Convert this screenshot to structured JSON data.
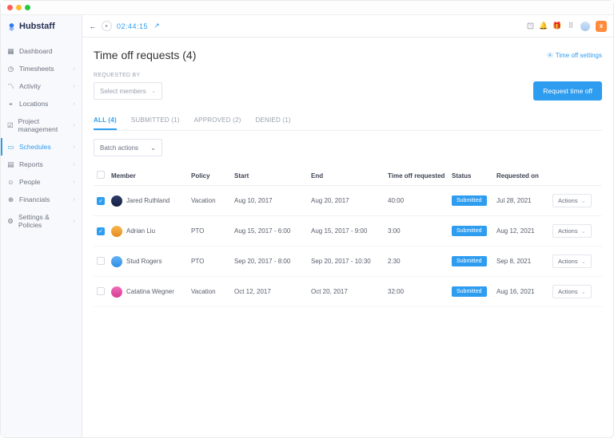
{
  "brand": "Hubstaff",
  "sidebar": {
    "items": [
      {
        "label": "Dashboard",
        "icon": "grid-icon",
        "chev": false
      },
      {
        "label": "Timesheets",
        "icon": "clock-icon",
        "chev": true
      },
      {
        "label": "Activity",
        "icon": "activity-icon",
        "chev": true
      },
      {
        "label": "Locations",
        "icon": "map-icon",
        "chev": true
      },
      {
        "label": "Project management",
        "icon": "clipboard-icon",
        "chev": true
      },
      {
        "label": "Schedules",
        "icon": "calendar-icon",
        "chev": true,
        "active": true
      },
      {
        "label": "Reports",
        "icon": "report-icon",
        "chev": true
      },
      {
        "label": "People",
        "icon": "people-icon",
        "chev": true
      },
      {
        "label": "Financials",
        "icon": "dollar-icon",
        "chev": true
      },
      {
        "label": "Settings & Policies",
        "icon": "sliders-icon",
        "chev": true
      }
    ]
  },
  "topbar": {
    "timer": "02:44:15",
    "org": "x"
  },
  "header": {
    "title": "Time off requests (4)",
    "settings_link": "Time off settings"
  },
  "filter": {
    "label": "REQUESTED BY",
    "select_placeholder": "Select members",
    "primary_button": "Request time off"
  },
  "tabs": [
    {
      "label": "ALL (4)",
      "active": true
    },
    {
      "label": "SUBMITTED (1)"
    },
    {
      "label": "APPROVED (2)"
    },
    {
      "label": "DENIED (1)"
    }
  ],
  "batch_actions": "Batch actions",
  "table": {
    "columns": [
      "",
      "Member",
      "Policy",
      "Start",
      "End",
      "Time off requested",
      "Status",
      "Requested on",
      ""
    ],
    "rows": [
      {
        "checked": true,
        "member": "Jared Ruthland",
        "policy": "Vacation",
        "start": "Aug 10, 2017",
        "end": "Aug 20, 2017",
        "requested": "40:00",
        "status": "Submitted",
        "on": "Jul 28, 2021",
        "actions": "Actions"
      },
      {
        "checked": true,
        "member": "Adrian Liu",
        "policy": "PTO",
        "start": "Aug 15, 2017 - 6:00",
        "end": "Aug 15, 2017 - 9:00",
        "requested": "3:00",
        "status": "Submitted",
        "on": "Aug 12, 2021",
        "actions": "Actions"
      },
      {
        "checked": false,
        "member": "Stud Rogers",
        "policy": "PTO",
        "start": "Sep 20, 2017 - 8:00",
        "end": "Sep 20, 2017 - 10:30",
        "requested": "2:30",
        "status": "Submitted",
        "on": "Sep 8, 2021",
        "actions": "Actions"
      },
      {
        "checked": false,
        "member": "Catatina Wegner",
        "policy": "Vacation",
        "start": "Oct 12, 2017",
        "end": "Oct 20, 2017",
        "requested": "32:00",
        "status": "Submitted",
        "on": "Aug 16, 2021",
        "actions": "Actions"
      }
    ]
  }
}
